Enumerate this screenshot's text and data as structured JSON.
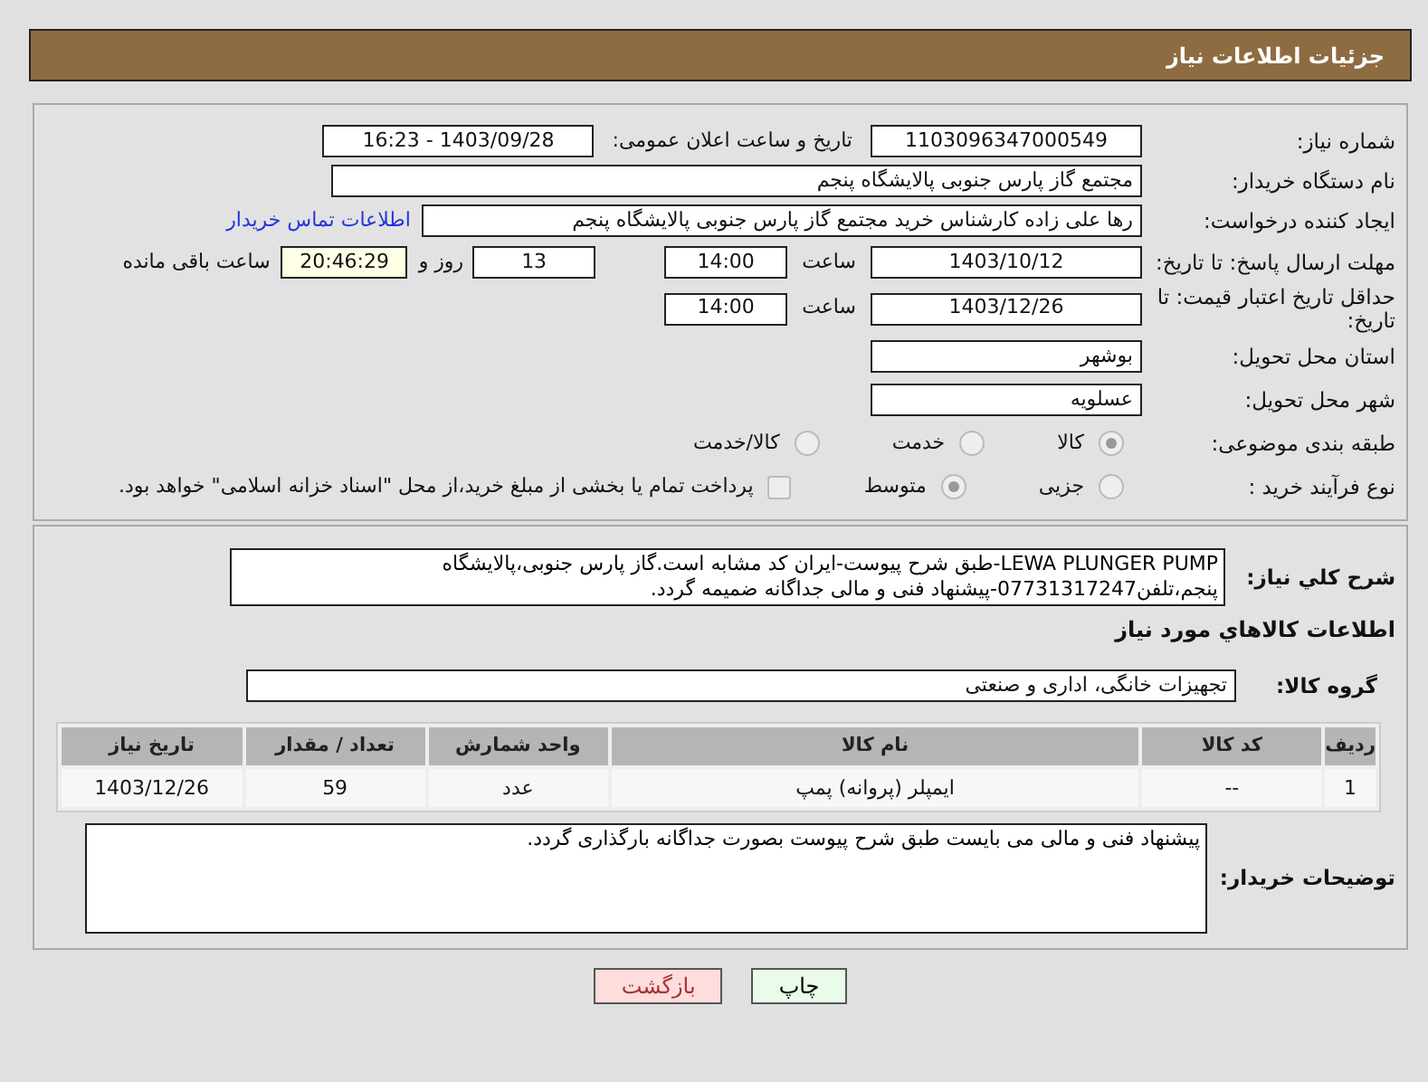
{
  "header": {
    "title": "جزئیات اطلاعات نیاز"
  },
  "need_number": {
    "label": "شماره نیاز:",
    "value": "1103096347000549"
  },
  "announce": {
    "label": "تاریخ و ساعت اعلان عمومی:",
    "value": "1403/09/28 - 16:23"
  },
  "buyer_org": {
    "label": "نام دستگاه خریدار:",
    "value": "مجتمع گاز پارس جنوبی  پالایشگاه پنجم"
  },
  "requester": {
    "label": "ایجاد کننده درخواست:",
    "value": "رها علی زاده کارشناس خرید مجتمع گاز پارس جنوبی  پالایشگاه پنجم",
    "link": "اطلاعات تماس خریدار"
  },
  "deadline": {
    "label": "مهلت ارسال پاسخ: تا تاریخ:",
    "date": "1403/10/12",
    "time_label": "ساعت",
    "time": "14:00",
    "days": "13",
    "days_label": "روز و",
    "remaining": "20:46:29",
    "remaining_label": "ساعت باقی مانده"
  },
  "validity": {
    "label": "حداقل تاریخ اعتبار قیمت: تا تاریخ:",
    "date": "1403/12/26",
    "time_label": "ساعت",
    "time": "14:00"
  },
  "province": {
    "label": "استان محل تحویل:",
    "value": "بوشهر"
  },
  "city": {
    "label": "شهر محل تحویل:",
    "value": "عسلویه"
  },
  "category": {
    "label": "طبقه بندی موضوعی:",
    "options": [
      {
        "label": "کالا",
        "selected": true
      },
      {
        "label": "خدمت",
        "selected": false
      },
      {
        "label": "کالا/خدمت",
        "selected": false
      }
    ]
  },
  "process": {
    "label": "نوع فرآیند خرید :",
    "options": [
      {
        "label": "جزیی",
        "selected": false
      },
      {
        "label": "متوسط",
        "selected": true
      }
    ],
    "checkbox": {
      "label": "پرداخت تمام یا بخشی از مبلغ خرید،از محل \"اسناد خزانه اسلامی\" خواهد بود.",
      "checked": false
    }
  },
  "description": {
    "label": "شرح کلي نياز:",
    "value": "LEWA PLUNGER PUMP-طبق شرح پیوست-ایران کد مشابه است.گاز پارس جنوبی،پالایشگاه پنجم،تلفن07731317247-پیشنهاد فنی و مالی جداگانه ضمیمه گردد."
  },
  "items_title": "اطلاعات کالاهاي مورد نياز",
  "group": {
    "label": "گروه کالا:",
    "value": "تجهیزات خانگی، اداری و صنعتی"
  },
  "table": {
    "columns": [
      "ردیف",
      "کد کالا",
      "نام کالا",
      "واحد شمارش",
      "تعداد / مقدار",
      "تاریخ نیاز"
    ],
    "rows": [
      [
        "1",
        "--",
        "ایمپلر (پروانه) پمپ",
        "عدد",
        "59",
        "1403/12/26"
      ]
    ]
  },
  "buyer_notes": {
    "label": "توضیحات خریدار:",
    "value": "پیشنهاد فنی و مالی می بایست طبق شرح پیوست بصورت جداگانه بارگذاری گردد."
  },
  "buttons": [
    {
      "label": "چاپ",
      "kind": "print"
    },
    {
      "label": "بازگشت",
      "kind": "back"
    }
  ]
}
